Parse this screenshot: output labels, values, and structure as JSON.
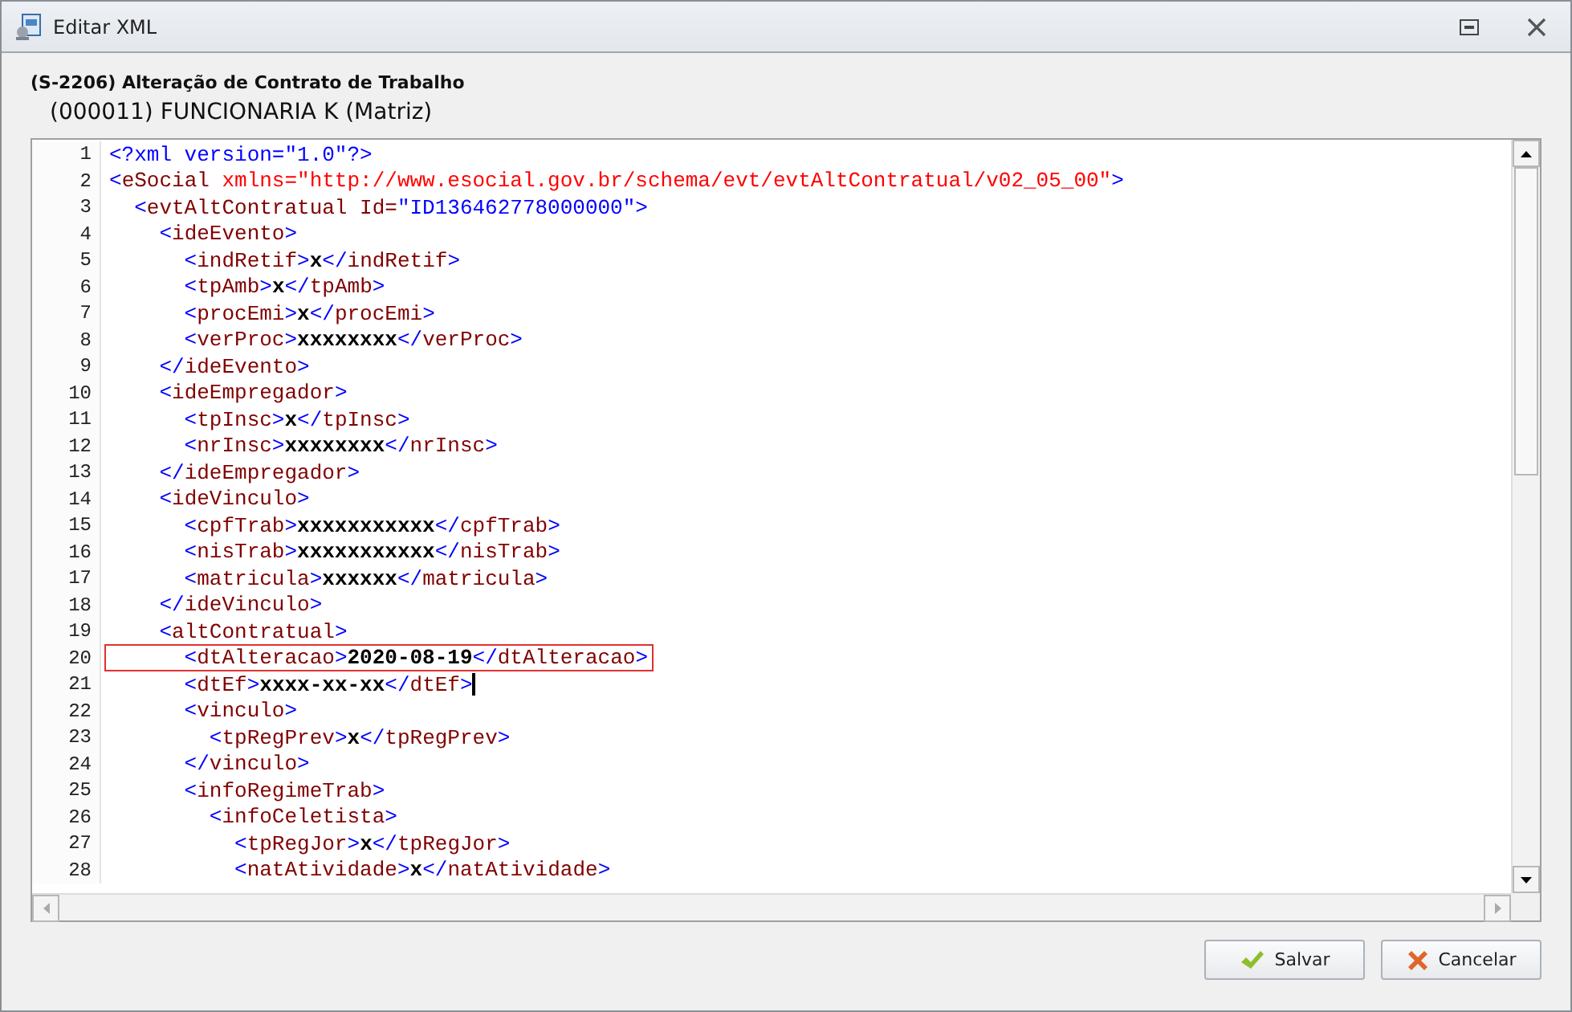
{
  "window": {
    "title": "Editar XML"
  },
  "header": {
    "event": "(S-2206) Alteração de Contrato de Trabalho",
    "employee": "(000011) FUNCIONARIA K (Matriz)"
  },
  "editor": {
    "lines": [
      {
        "number": "1",
        "highlighted": false,
        "caret": false,
        "tokens": [
          {
            "kind": "punct",
            "text": "<?xml version=\"1.0\"?>"
          }
        ]
      },
      {
        "number": "2",
        "highlighted": false,
        "caret": false,
        "tokens": [
          {
            "kind": "punct",
            "text": "<"
          },
          {
            "kind": "name",
            "text": "eSocial"
          },
          {
            "kind": "attr",
            "text": " xmlns=\"http://www.esocial.gov.br/schema/evt/evtAltContratual/v02_05_00\""
          },
          {
            "kind": "punct",
            "text": ">"
          }
        ]
      },
      {
        "number": "3",
        "highlighted": false,
        "caret": false,
        "tokens": [
          {
            "kind": "punct",
            "text": "  <"
          },
          {
            "kind": "name",
            "text": "evtAltContratual Id="
          },
          {
            "kind": "punct",
            "text": "\"ID136462778000000\">"
          }
        ]
      },
      {
        "number": "4",
        "highlighted": false,
        "caret": false,
        "tokens": [
          {
            "kind": "punct",
            "text": "    <"
          },
          {
            "kind": "name",
            "text": "ideEvento"
          },
          {
            "kind": "punct",
            "text": ">"
          }
        ]
      },
      {
        "number": "5",
        "highlighted": false,
        "caret": false,
        "tokens": [
          {
            "kind": "punct",
            "text": "      <"
          },
          {
            "kind": "name",
            "text": "indRetif"
          },
          {
            "kind": "punct",
            "text": ">"
          },
          {
            "kind": "text",
            "text": "x"
          },
          {
            "kind": "punct",
            "text": "</"
          },
          {
            "kind": "name",
            "text": "indRetif"
          },
          {
            "kind": "punct",
            "text": ">"
          }
        ]
      },
      {
        "number": "6",
        "highlighted": false,
        "caret": false,
        "tokens": [
          {
            "kind": "punct",
            "text": "      <"
          },
          {
            "kind": "name",
            "text": "tpAmb"
          },
          {
            "kind": "punct",
            "text": ">"
          },
          {
            "kind": "text",
            "text": "x"
          },
          {
            "kind": "punct",
            "text": "</"
          },
          {
            "kind": "name",
            "text": "tpAmb"
          },
          {
            "kind": "punct",
            "text": ">"
          }
        ]
      },
      {
        "number": "7",
        "highlighted": false,
        "caret": false,
        "tokens": [
          {
            "kind": "punct",
            "text": "      <"
          },
          {
            "kind": "name",
            "text": "procEmi"
          },
          {
            "kind": "punct",
            "text": ">"
          },
          {
            "kind": "text",
            "text": "x"
          },
          {
            "kind": "punct",
            "text": "</"
          },
          {
            "kind": "name",
            "text": "procEmi"
          },
          {
            "kind": "punct",
            "text": ">"
          }
        ]
      },
      {
        "number": "8",
        "highlighted": false,
        "caret": false,
        "tokens": [
          {
            "kind": "punct",
            "text": "      <"
          },
          {
            "kind": "name",
            "text": "verProc"
          },
          {
            "kind": "punct",
            "text": ">"
          },
          {
            "kind": "text",
            "text": "xxxxxxxx"
          },
          {
            "kind": "punct",
            "text": "</"
          },
          {
            "kind": "name",
            "text": "verProc"
          },
          {
            "kind": "punct",
            "text": ">"
          }
        ]
      },
      {
        "number": "9",
        "highlighted": false,
        "caret": false,
        "tokens": [
          {
            "kind": "punct",
            "text": "    </"
          },
          {
            "kind": "name",
            "text": "ideEvento"
          },
          {
            "kind": "punct",
            "text": ">"
          }
        ]
      },
      {
        "number": "10",
        "highlighted": false,
        "caret": false,
        "tokens": [
          {
            "kind": "punct",
            "text": "    <"
          },
          {
            "kind": "name",
            "text": "ideEmpregador"
          },
          {
            "kind": "punct",
            "text": ">"
          }
        ]
      },
      {
        "number": "11",
        "highlighted": false,
        "caret": false,
        "tokens": [
          {
            "kind": "punct",
            "text": "      <"
          },
          {
            "kind": "name",
            "text": "tpInsc"
          },
          {
            "kind": "punct",
            "text": ">"
          },
          {
            "kind": "text",
            "text": "x"
          },
          {
            "kind": "punct",
            "text": "</"
          },
          {
            "kind": "name",
            "text": "tpInsc"
          },
          {
            "kind": "punct",
            "text": ">"
          }
        ]
      },
      {
        "number": "12",
        "highlighted": false,
        "caret": false,
        "tokens": [
          {
            "kind": "punct",
            "text": "      <"
          },
          {
            "kind": "name",
            "text": "nrInsc"
          },
          {
            "kind": "punct",
            "text": ">"
          },
          {
            "kind": "text",
            "text": "xxxxxxxx"
          },
          {
            "kind": "punct",
            "text": "</"
          },
          {
            "kind": "name",
            "text": "nrInsc"
          },
          {
            "kind": "punct",
            "text": ">"
          }
        ]
      },
      {
        "number": "13",
        "highlighted": false,
        "caret": false,
        "tokens": [
          {
            "kind": "punct",
            "text": "    </"
          },
          {
            "kind": "name",
            "text": "ideEmpregador"
          },
          {
            "kind": "punct",
            "text": ">"
          }
        ]
      },
      {
        "number": "14",
        "highlighted": false,
        "caret": false,
        "tokens": [
          {
            "kind": "punct",
            "text": "    <"
          },
          {
            "kind": "name",
            "text": "ideVinculo"
          },
          {
            "kind": "punct",
            "text": ">"
          }
        ]
      },
      {
        "number": "15",
        "highlighted": false,
        "caret": false,
        "tokens": [
          {
            "kind": "punct",
            "text": "      <"
          },
          {
            "kind": "name",
            "text": "cpfTrab"
          },
          {
            "kind": "punct",
            "text": ">"
          },
          {
            "kind": "text",
            "text": "xxxxxxxxxxx"
          },
          {
            "kind": "punct",
            "text": "</"
          },
          {
            "kind": "name",
            "text": "cpfTrab"
          },
          {
            "kind": "punct",
            "text": ">"
          }
        ]
      },
      {
        "number": "16",
        "highlighted": false,
        "caret": false,
        "tokens": [
          {
            "kind": "punct",
            "text": "      <"
          },
          {
            "kind": "name",
            "text": "nisTrab"
          },
          {
            "kind": "punct",
            "text": ">"
          },
          {
            "kind": "text",
            "text": "xxxxxxxxxxx"
          },
          {
            "kind": "punct",
            "text": "</"
          },
          {
            "kind": "name",
            "text": "nisTrab"
          },
          {
            "kind": "punct",
            "text": ">"
          }
        ]
      },
      {
        "number": "17",
        "highlighted": false,
        "caret": false,
        "tokens": [
          {
            "kind": "punct",
            "text": "      <"
          },
          {
            "kind": "name",
            "text": "matricula"
          },
          {
            "kind": "punct",
            "text": ">"
          },
          {
            "kind": "text",
            "text": "xxxxxx"
          },
          {
            "kind": "punct",
            "text": "</"
          },
          {
            "kind": "name",
            "text": "matricula"
          },
          {
            "kind": "punct",
            "text": ">"
          }
        ]
      },
      {
        "number": "18",
        "highlighted": false,
        "caret": false,
        "tokens": [
          {
            "kind": "punct",
            "text": "    </"
          },
          {
            "kind": "name",
            "text": "ideVinculo"
          },
          {
            "kind": "punct",
            "text": ">"
          }
        ]
      },
      {
        "number": "19",
        "highlighted": false,
        "caret": false,
        "tokens": [
          {
            "kind": "punct",
            "text": "    <"
          },
          {
            "kind": "name",
            "text": "altContratual"
          },
          {
            "kind": "punct",
            "text": ">"
          }
        ]
      },
      {
        "number": "20",
        "highlighted": true,
        "caret": false,
        "tokens": [
          {
            "kind": "punct",
            "text": "      <"
          },
          {
            "kind": "name",
            "text": "dtAlteracao"
          },
          {
            "kind": "punct",
            "text": ">"
          },
          {
            "kind": "text",
            "text": "2020-08-19"
          },
          {
            "kind": "punct",
            "text": "</"
          },
          {
            "kind": "name",
            "text": "dtAlteracao"
          },
          {
            "kind": "punct",
            "text": ">"
          }
        ]
      },
      {
        "number": "21",
        "highlighted": false,
        "caret": true,
        "tokens": [
          {
            "kind": "punct",
            "text": "      <"
          },
          {
            "kind": "name",
            "text": "dtEf"
          },
          {
            "kind": "punct",
            "text": ">"
          },
          {
            "kind": "text",
            "text": "xxxx-xx-xx"
          },
          {
            "kind": "punct",
            "text": "</"
          },
          {
            "kind": "name",
            "text": "dtEf"
          },
          {
            "kind": "punct",
            "text": ">"
          }
        ]
      },
      {
        "number": "22",
        "highlighted": false,
        "caret": false,
        "tokens": [
          {
            "kind": "punct",
            "text": "      <"
          },
          {
            "kind": "name",
            "text": "vinculo"
          },
          {
            "kind": "punct",
            "text": ">"
          }
        ]
      },
      {
        "number": "23",
        "highlighted": false,
        "caret": false,
        "tokens": [
          {
            "kind": "punct",
            "text": "        <"
          },
          {
            "kind": "name",
            "text": "tpRegPrev"
          },
          {
            "kind": "punct",
            "text": ">"
          },
          {
            "kind": "text",
            "text": "x"
          },
          {
            "kind": "punct",
            "text": "</"
          },
          {
            "kind": "name",
            "text": "tpRegPrev"
          },
          {
            "kind": "punct",
            "text": ">"
          }
        ]
      },
      {
        "number": "24",
        "highlighted": false,
        "caret": false,
        "tokens": [
          {
            "kind": "punct",
            "text": "      </"
          },
          {
            "kind": "name",
            "text": "vinculo"
          },
          {
            "kind": "punct",
            "text": ">"
          }
        ]
      },
      {
        "number": "25",
        "highlighted": false,
        "caret": false,
        "tokens": [
          {
            "kind": "punct",
            "text": "      <"
          },
          {
            "kind": "name",
            "text": "infoRegimeTrab"
          },
          {
            "kind": "punct",
            "text": ">"
          }
        ]
      },
      {
        "number": "26",
        "highlighted": false,
        "caret": false,
        "tokens": [
          {
            "kind": "punct",
            "text": "        <"
          },
          {
            "kind": "name",
            "text": "infoCeletista"
          },
          {
            "kind": "punct",
            "text": ">"
          }
        ]
      },
      {
        "number": "27",
        "highlighted": false,
        "caret": false,
        "tokens": [
          {
            "kind": "punct",
            "text": "          <"
          },
          {
            "kind": "name",
            "text": "tpRegJor"
          },
          {
            "kind": "punct",
            "text": ">"
          },
          {
            "kind": "text",
            "text": "x"
          },
          {
            "kind": "punct",
            "text": "</"
          },
          {
            "kind": "name",
            "text": "tpRegJor"
          },
          {
            "kind": "punct",
            "text": ">"
          }
        ]
      },
      {
        "number": "28",
        "highlighted": false,
        "caret": false,
        "tokens": [
          {
            "kind": "punct",
            "text": "          <"
          },
          {
            "kind": "name",
            "text": "natAtividade"
          },
          {
            "kind": "punct",
            "text": ">"
          },
          {
            "kind": "text",
            "text": "x"
          },
          {
            "kind": "punct",
            "text": "</"
          },
          {
            "kind": "name",
            "text": "natAtividade"
          },
          {
            "kind": "punct",
            "text": ">"
          }
        ]
      }
    ]
  },
  "buttons": [
    {
      "kind": "save",
      "label": "Salvar"
    },
    {
      "kind": "cancel",
      "label": "Cancelar"
    }
  ]
}
